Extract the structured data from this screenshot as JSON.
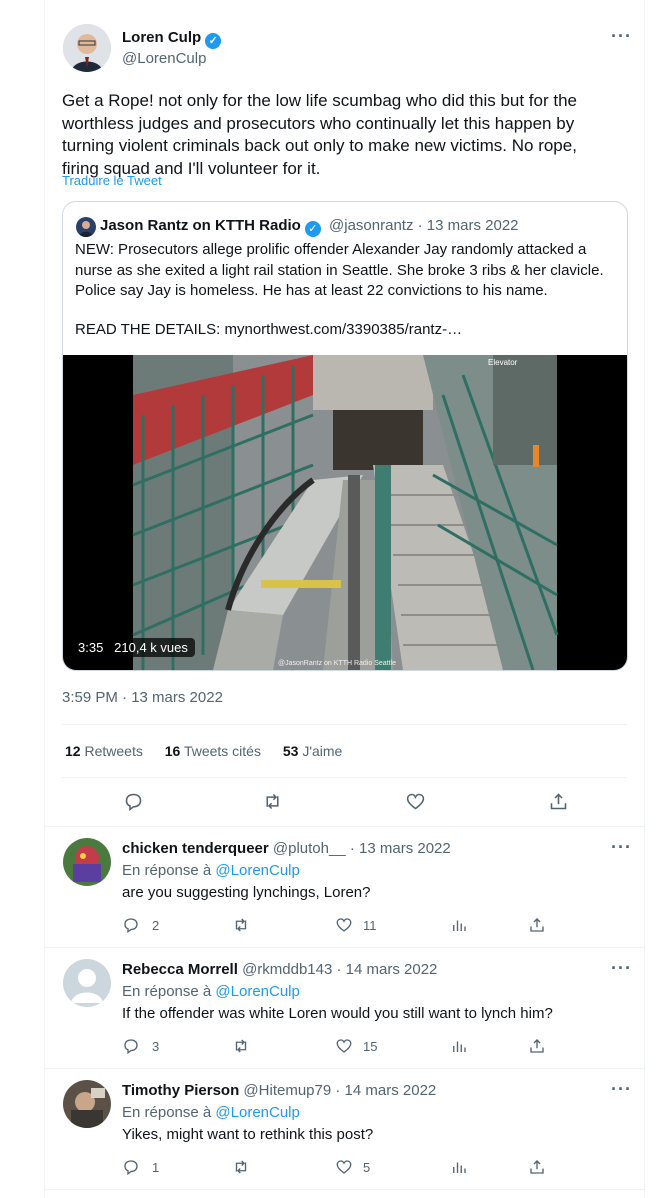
{
  "main_tweet": {
    "author_name": "Loren Culp",
    "handle": "@LorenCulp",
    "text": "Get a Rope!  not only for the low life scumbag who did this but for the worthless judges and prosecutors who continually let this happen by turning violent criminals back out only to make new victims.  No rope, firing squad and I'll volunteer for it.",
    "translate": "Traduire le Tweet",
    "timestamp": "3:59 PM · 13 mars 2022",
    "stats": {
      "retweets_count": "12",
      "retweets_label": "Retweets",
      "quotes_count": "16",
      "quotes_label": "Tweets cités",
      "likes_count": "53",
      "likes_label": "J'aime"
    }
  },
  "quoted_tweet": {
    "author_name": "Jason Rantz on KTTH Radio",
    "handle": "@jasonrantz",
    "date": "· 13 mars 2022",
    "text": "NEW: Prosecutors allege prolific offender Alexander Jay randomly attacked a nurse as she exited a light rail station in Seattle. She broke 3 ribs & her clavicle. Police say Jay is homeless. He has at least 22 convictions to his name.",
    "details": "READ THE DETAILS: mynorthwest.com/3390385/rantz-…",
    "video": {
      "duration": "3:35",
      "views": "210,4 k vues",
      "watermark": "@JasonRantz on KTTH Radio Seattle",
      "sign": "Elevator"
    }
  },
  "replies": [
    {
      "author_name": "chicken tenderqueer",
      "handle": "@plutoh__",
      "date": "· 13 mars 2022",
      "reply_prefix": "En réponse à",
      "reply_to": "@LorenCulp",
      "text": "are you suggesting lynchings, Loren?",
      "reply_count": "2",
      "retweet_count": "",
      "like_count": "11"
    },
    {
      "author_name": "Rebecca Morrell",
      "handle": "@rkmddb143",
      "date": "· 14 mars 2022",
      "reply_prefix": "En réponse à",
      "reply_to": "@LorenCulp",
      "text": "If the offender was white Loren would you still want to lynch him?",
      "reply_count": "3",
      "retweet_count": "",
      "like_count": "15"
    },
    {
      "author_name": "Timothy Pierson",
      "handle": "@Hitemup79",
      "date": "· 14 mars 2022",
      "reply_prefix": "En réponse à",
      "reply_to": "@LorenCulp",
      "text": "Yikes, might want to rethink this post?",
      "reply_count": "1",
      "retweet_count": "",
      "like_count": "5"
    }
  ],
  "icons": {
    "more": "more-dots-icon",
    "verified": "verified-badge-icon",
    "reply": "reply-icon",
    "retweet": "retweet-icon",
    "like": "heart-icon",
    "share": "share-icon",
    "analytics": "analytics-icon"
  },
  "colors": {
    "accent": "#1d9bf0",
    "muted": "#536471",
    "text": "#0f1419"
  }
}
